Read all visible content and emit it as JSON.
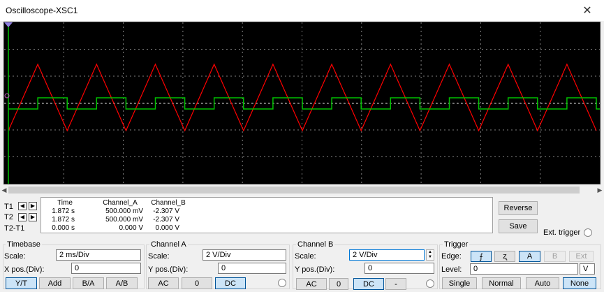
{
  "window": {
    "title": "Oscilloscope-XSC1",
    "close_glyph": "✕"
  },
  "scope": {
    "background": "#000000",
    "grid_color": "#808080",
    "channel_a_color": "#ff0000",
    "channel_b_color": "#00c000",
    "cursor_color": "#ffffff"
  },
  "readout": {
    "headers": [
      "Time",
      "Channel_A",
      "Channel_B"
    ],
    "rows": [
      {
        "label": "T1",
        "time": "1.872 s",
        "a": "500.000 mV",
        "b": "-2.307 V"
      },
      {
        "label": "T2",
        "time": "1.872 s",
        "a": "500.000 mV",
        "b": "-2.307 V"
      },
      {
        "label": "T2-T1",
        "time": "0.000 s",
        "a": "0.000 V",
        "b": "0.000 V"
      }
    ]
  },
  "buttons": {
    "reverse": "Reverse",
    "save": "Save",
    "ext_trigger": "Ext. trigger"
  },
  "timebase": {
    "title": "Timebase",
    "scale_label": "Scale:",
    "scale": "2 ms/Div",
    "xpos_label": "X pos.(Div):",
    "xpos": "0",
    "modes": [
      "Y/T",
      "Add",
      "B/A",
      "A/B"
    ]
  },
  "channel_a": {
    "title": "Channel A",
    "scale_label": "Scale:",
    "scale": "2  V/Div",
    "ypos_label": "Y pos.(Div):",
    "ypos": "0",
    "coupling": [
      "AC",
      "0",
      "DC"
    ]
  },
  "channel_b": {
    "title": "Channel B",
    "scale_label": "Scale:",
    "scale": "2  V/Div",
    "ypos_label": "Y pos.(Div):",
    "ypos": "0",
    "coupling": [
      "AC",
      "0",
      "DC",
      "-"
    ]
  },
  "trigger": {
    "title": "Trigger",
    "edge_label": "Edge:",
    "level_label": "Level:",
    "level": "0",
    "level_unit": "V",
    "sources": [
      "A",
      "B",
      "Ext"
    ],
    "modes": [
      "Single",
      "Normal",
      "Auto",
      "None"
    ],
    "rising_glyph": "⨍",
    "falling_glyph": "ʐ"
  },
  "scroll": {
    "left": "◀",
    "right": "▶"
  }
}
